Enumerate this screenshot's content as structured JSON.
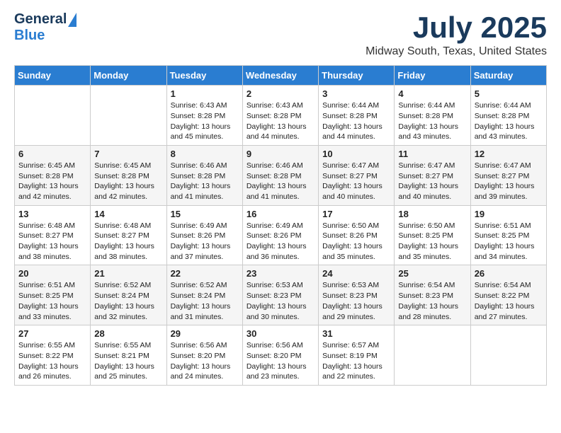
{
  "header": {
    "logo_general": "General",
    "logo_blue": "Blue",
    "title": "July 2025",
    "subtitle": "Midway South, Texas, United States"
  },
  "days_of_week": [
    "Sunday",
    "Monday",
    "Tuesday",
    "Wednesday",
    "Thursday",
    "Friday",
    "Saturday"
  ],
  "weeks": [
    [
      {
        "day": "",
        "sunrise": "",
        "sunset": "",
        "daylight": ""
      },
      {
        "day": "",
        "sunrise": "",
        "sunset": "",
        "daylight": ""
      },
      {
        "day": "1",
        "sunrise": "Sunrise: 6:43 AM",
        "sunset": "Sunset: 8:28 PM",
        "daylight": "Daylight: 13 hours and 45 minutes."
      },
      {
        "day": "2",
        "sunrise": "Sunrise: 6:43 AM",
        "sunset": "Sunset: 8:28 PM",
        "daylight": "Daylight: 13 hours and 44 minutes."
      },
      {
        "day": "3",
        "sunrise": "Sunrise: 6:44 AM",
        "sunset": "Sunset: 8:28 PM",
        "daylight": "Daylight: 13 hours and 44 minutes."
      },
      {
        "day": "4",
        "sunrise": "Sunrise: 6:44 AM",
        "sunset": "Sunset: 8:28 PM",
        "daylight": "Daylight: 13 hours and 43 minutes."
      },
      {
        "day": "5",
        "sunrise": "Sunrise: 6:44 AM",
        "sunset": "Sunset: 8:28 PM",
        "daylight": "Daylight: 13 hours and 43 minutes."
      }
    ],
    [
      {
        "day": "6",
        "sunrise": "Sunrise: 6:45 AM",
        "sunset": "Sunset: 8:28 PM",
        "daylight": "Daylight: 13 hours and 42 minutes."
      },
      {
        "day": "7",
        "sunrise": "Sunrise: 6:45 AM",
        "sunset": "Sunset: 8:28 PM",
        "daylight": "Daylight: 13 hours and 42 minutes."
      },
      {
        "day": "8",
        "sunrise": "Sunrise: 6:46 AM",
        "sunset": "Sunset: 8:28 PM",
        "daylight": "Daylight: 13 hours and 41 minutes."
      },
      {
        "day": "9",
        "sunrise": "Sunrise: 6:46 AM",
        "sunset": "Sunset: 8:28 PM",
        "daylight": "Daylight: 13 hours and 41 minutes."
      },
      {
        "day": "10",
        "sunrise": "Sunrise: 6:47 AM",
        "sunset": "Sunset: 8:27 PM",
        "daylight": "Daylight: 13 hours and 40 minutes."
      },
      {
        "day": "11",
        "sunrise": "Sunrise: 6:47 AM",
        "sunset": "Sunset: 8:27 PM",
        "daylight": "Daylight: 13 hours and 40 minutes."
      },
      {
        "day": "12",
        "sunrise": "Sunrise: 6:47 AM",
        "sunset": "Sunset: 8:27 PM",
        "daylight": "Daylight: 13 hours and 39 minutes."
      }
    ],
    [
      {
        "day": "13",
        "sunrise": "Sunrise: 6:48 AM",
        "sunset": "Sunset: 8:27 PM",
        "daylight": "Daylight: 13 hours and 38 minutes."
      },
      {
        "day": "14",
        "sunrise": "Sunrise: 6:48 AM",
        "sunset": "Sunset: 8:27 PM",
        "daylight": "Daylight: 13 hours and 38 minutes."
      },
      {
        "day": "15",
        "sunrise": "Sunrise: 6:49 AM",
        "sunset": "Sunset: 8:26 PM",
        "daylight": "Daylight: 13 hours and 37 minutes."
      },
      {
        "day": "16",
        "sunrise": "Sunrise: 6:49 AM",
        "sunset": "Sunset: 8:26 PM",
        "daylight": "Daylight: 13 hours and 36 minutes."
      },
      {
        "day": "17",
        "sunrise": "Sunrise: 6:50 AM",
        "sunset": "Sunset: 8:26 PM",
        "daylight": "Daylight: 13 hours and 35 minutes."
      },
      {
        "day": "18",
        "sunrise": "Sunrise: 6:50 AM",
        "sunset": "Sunset: 8:25 PM",
        "daylight": "Daylight: 13 hours and 35 minutes."
      },
      {
        "day": "19",
        "sunrise": "Sunrise: 6:51 AM",
        "sunset": "Sunset: 8:25 PM",
        "daylight": "Daylight: 13 hours and 34 minutes."
      }
    ],
    [
      {
        "day": "20",
        "sunrise": "Sunrise: 6:51 AM",
        "sunset": "Sunset: 8:25 PM",
        "daylight": "Daylight: 13 hours and 33 minutes."
      },
      {
        "day": "21",
        "sunrise": "Sunrise: 6:52 AM",
        "sunset": "Sunset: 8:24 PM",
        "daylight": "Daylight: 13 hours and 32 minutes."
      },
      {
        "day": "22",
        "sunrise": "Sunrise: 6:52 AM",
        "sunset": "Sunset: 8:24 PM",
        "daylight": "Daylight: 13 hours and 31 minutes."
      },
      {
        "day": "23",
        "sunrise": "Sunrise: 6:53 AM",
        "sunset": "Sunset: 8:23 PM",
        "daylight": "Daylight: 13 hours and 30 minutes."
      },
      {
        "day": "24",
        "sunrise": "Sunrise: 6:53 AM",
        "sunset": "Sunset: 8:23 PM",
        "daylight": "Daylight: 13 hours and 29 minutes."
      },
      {
        "day": "25",
        "sunrise": "Sunrise: 6:54 AM",
        "sunset": "Sunset: 8:23 PM",
        "daylight": "Daylight: 13 hours and 28 minutes."
      },
      {
        "day": "26",
        "sunrise": "Sunrise: 6:54 AM",
        "sunset": "Sunset: 8:22 PM",
        "daylight": "Daylight: 13 hours and 27 minutes."
      }
    ],
    [
      {
        "day": "27",
        "sunrise": "Sunrise: 6:55 AM",
        "sunset": "Sunset: 8:22 PM",
        "daylight": "Daylight: 13 hours and 26 minutes."
      },
      {
        "day": "28",
        "sunrise": "Sunrise: 6:55 AM",
        "sunset": "Sunset: 8:21 PM",
        "daylight": "Daylight: 13 hours and 25 minutes."
      },
      {
        "day": "29",
        "sunrise": "Sunrise: 6:56 AM",
        "sunset": "Sunset: 8:20 PM",
        "daylight": "Daylight: 13 hours and 24 minutes."
      },
      {
        "day": "30",
        "sunrise": "Sunrise: 6:56 AM",
        "sunset": "Sunset: 8:20 PM",
        "daylight": "Daylight: 13 hours and 23 minutes."
      },
      {
        "day": "31",
        "sunrise": "Sunrise: 6:57 AM",
        "sunset": "Sunset: 8:19 PM",
        "daylight": "Daylight: 13 hours and 22 minutes."
      },
      {
        "day": "",
        "sunrise": "",
        "sunset": "",
        "daylight": ""
      },
      {
        "day": "",
        "sunrise": "",
        "sunset": "",
        "daylight": ""
      }
    ]
  ]
}
